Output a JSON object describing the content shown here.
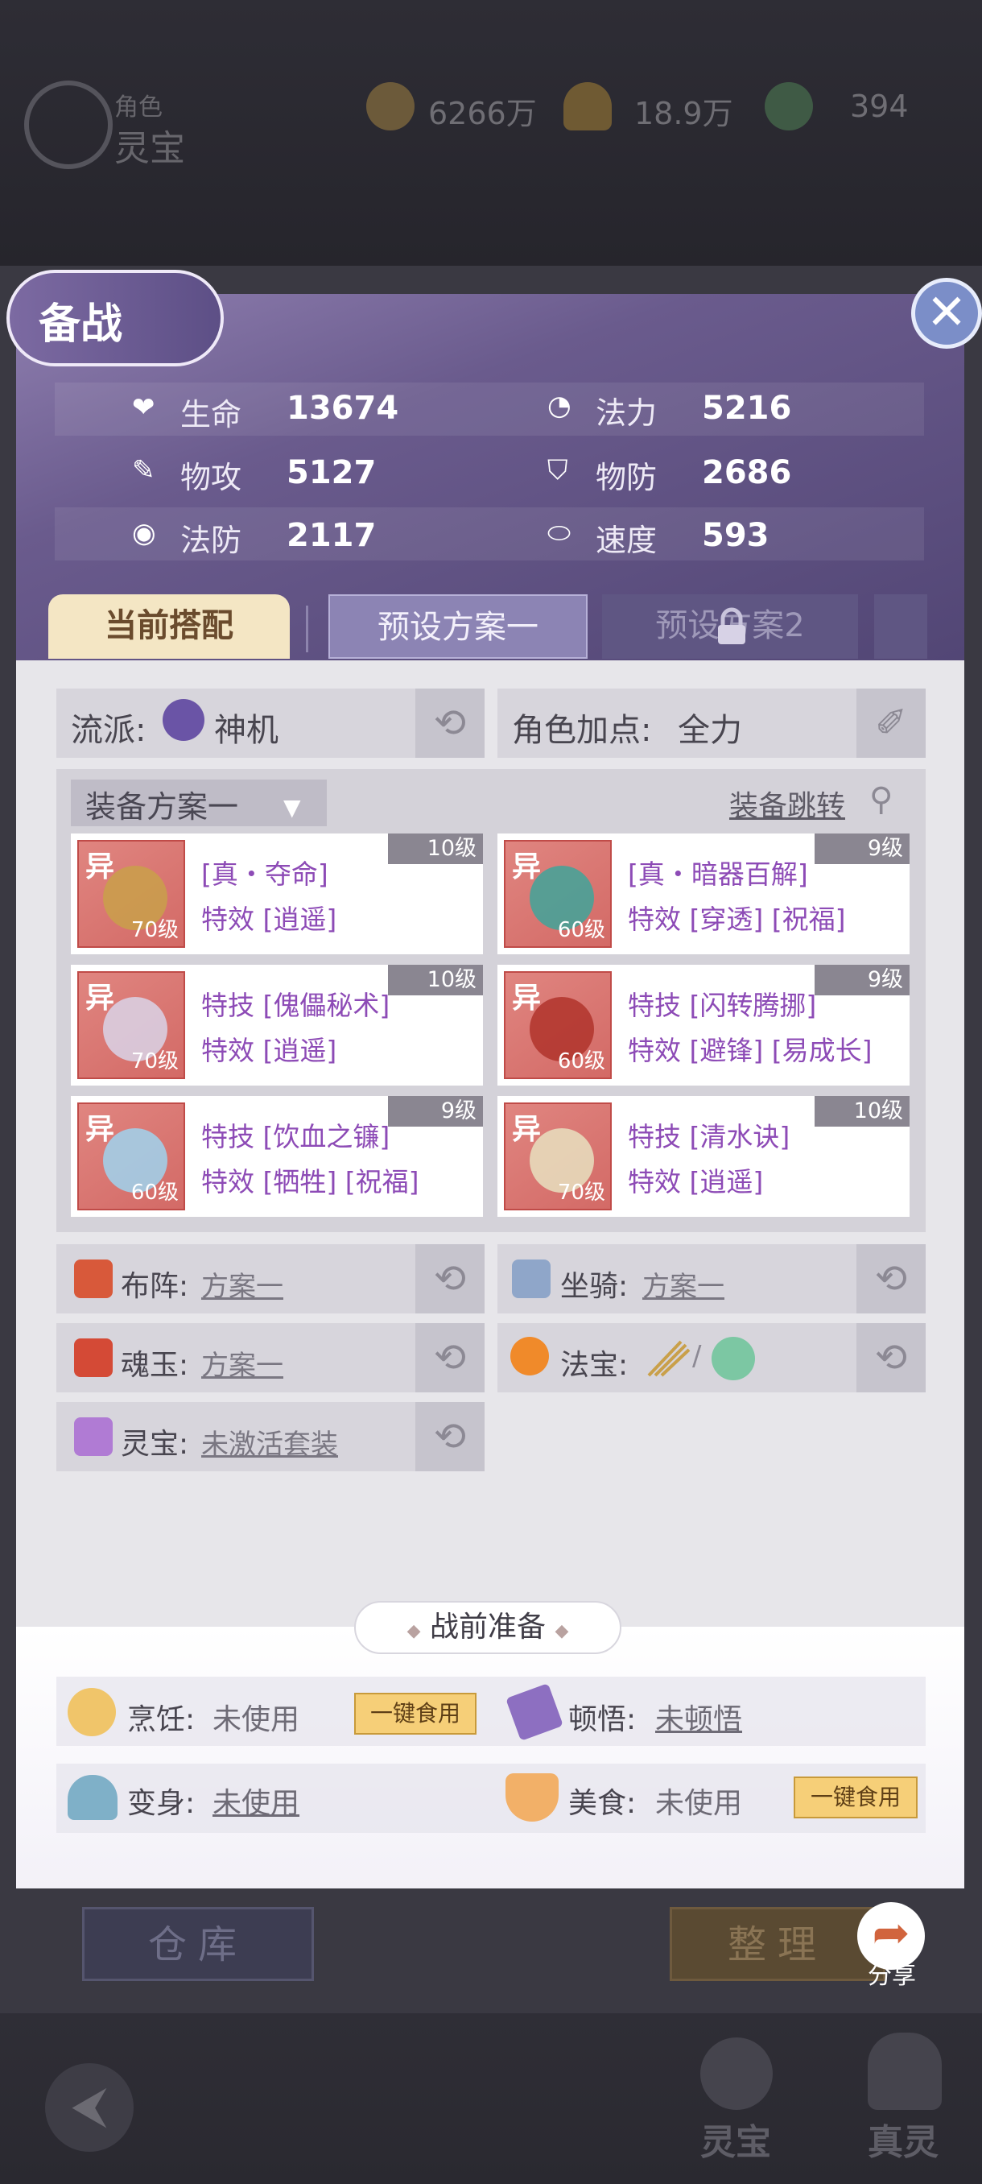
{
  "topbar": {
    "subtitle": "角色",
    "title": "灵宝",
    "currency": [
      {
        "icon": "coin-icon",
        "value": "6266万"
      },
      {
        "icon": "gold-ingot-icon",
        "value": "18.9万"
      },
      {
        "icon": "jade-dragon-icon",
        "value": "394"
      }
    ]
  },
  "panel": {
    "title": "备战",
    "stats": [
      {
        "icon": "heart-icon",
        "label": "生命",
        "value": "13674"
      },
      {
        "icon": "swirl-icon",
        "label": "法力",
        "value": "5216"
      },
      {
        "icon": "feather-icon",
        "label": "物攻",
        "value": "5127"
      },
      {
        "icon": "shield-icon",
        "label": "物防",
        "value": "2686"
      },
      {
        "icon": "magic-shield-icon",
        "label": "法防",
        "value": "2117"
      },
      {
        "icon": "boot-icon",
        "label": "速度",
        "value": "593"
      }
    ],
    "tabs": [
      {
        "label": "当前搭配"
      },
      {
        "label": "预设方案一"
      },
      {
        "label": "预设方案2"
      }
    ],
    "school": {
      "label": "流派:",
      "value": "神机"
    },
    "attribute": {
      "label": "角色加点:",
      "value": "全力"
    },
    "equip_set": {
      "label": "装备方案一",
      "jump": "装备跳转"
    },
    "equipment": [
      {
        "tag": "异",
        "level": "70级",
        "badge": "10级",
        "line1": "[真・夺命]",
        "line2": "特效 [逍遥]",
        "art_color": "#c9a04a"
      },
      {
        "tag": "异",
        "level": "60级",
        "badge": "9级",
        "line1": "[真・暗器百解]",
        "line2": "特效 [穿透] [祝福]",
        "art_color": "#3fa59a"
      },
      {
        "tag": "异",
        "level": "70级",
        "badge": "10级",
        "line1": "特技 [傀儡秘术]",
        "line2": "特效 [逍遥]",
        "art_color": "#d9d4e8"
      },
      {
        "tag": "异",
        "level": "60级",
        "badge": "9级",
        "line1": "特技 [闪转腾挪]",
        "line2": "特效 [避锋] [易成长]",
        "art_color": "#b0342c"
      },
      {
        "tag": "异",
        "level": "60级",
        "badge": "9级",
        "line1": "特技 [饮血之镰]",
        "line2": "特效 [牺牲] [祝福]",
        "art_color": "#9fd3ef"
      },
      {
        "tag": "异",
        "level": "70级",
        "badge": "10级",
        "line1": "特技 [清水诀]",
        "line2": "特效 [逍遥]",
        "art_color": "#e8e1c0"
      }
    ],
    "options": [
      {
        "label": "布阵:",
        "value": "方案一"
      },
      {
        "label": "坐骑:",
        "value": "方案一"
      },
      {
        "label": "魂玉:",
        "value": "方案一"
      },
      {
        "label": "法宝:",
        "value": ""
      },
      {
        "label": "灵宝:",
        "value": "未激活套装"
      }
    ],
    "prep": {
      "title": "战前准备",
      "cooking": {
        "label": "烹饪:",
        "value": "未使用",
        "button": "一键食用"
      },
      "insight": {
        "label": "顿悟:",
        "value": "未顿悟"
      },
      "transform": {
        "label": "变身:",
        "value": "未使用"
      },
      "food": {
        "label": "美食:",
        "value": "未使用",
        "button": "一键食用"
      }
    }
  },
  "bottom": {
    "warehouse": "仓库",
    "arrange": "整理",
    "share": "分享",
    "nav": [
      {
        "label": "灵宝"
      },
      {
        "label": "真灵"
      }
    ]
  }
}
